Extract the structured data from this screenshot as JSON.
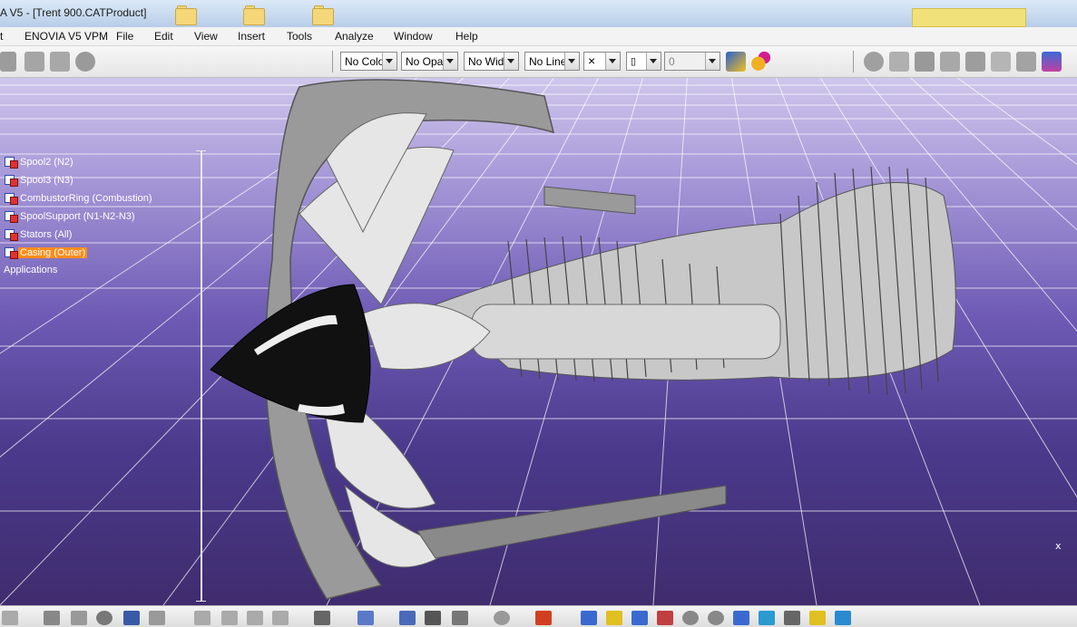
{
  "window": {
    "title": "A V5 - [Trent 900.CATProduct]"
  },
  "menu": {
    "items": [
      "t",
      "ENOVIA V5 VPM",
      "File",
      "Edit",
      "View",
      "Insert",
      "Tools",
      "Analyze",
      "Window",
      "Help"
    ]
  },
  "toolbar": {
    "color_combo": "No Colo",
    "opacity_combo": "No Opa",
    "width_combo": "No Wid",
    "linetype_combo": "No Line",
    "point_combo": "×",
    "layer_combo": "0",
    "icons": [
      "graph-icon",
      "catalog-icon",
      "update-icon",
      "paint-brush-icon",
      "format-painter-icon",
      "measure-icon",
      "cube-icon",
      "render-icon",
      "analysis-icon",
      "snap-icon",
      "pencil-icon",
      "table-icon",
      "network-icon"
    ]
  },
  "tree": {
    "items": [
      {
        "label": "Spool2 (N2)",
        "selected": false
      },
      {
        "label": "Spool3 (N3)",
        "selected": false
      },
      {
        "label": "CombustorRing (Combustion)",
        "selected": false
      },
      {
        "label": "SpoolSupport (N1-N2-N3)",
        "selected": false
      },
      {
        "label": "Stators (All)",
        "selected": false
      },
      {
        "label": "Casing (Outer)",
        "selected": true
      }
    ],
    "applications_label": "Applications"
  },
  "viewport": {
    "compass_label": "x"
  },
  "colors": {
    "selection": "#ff8c1a",
    "background_top": "#cfc7ec",
    "background_bottom": "#3f2c6e"
  }
}
